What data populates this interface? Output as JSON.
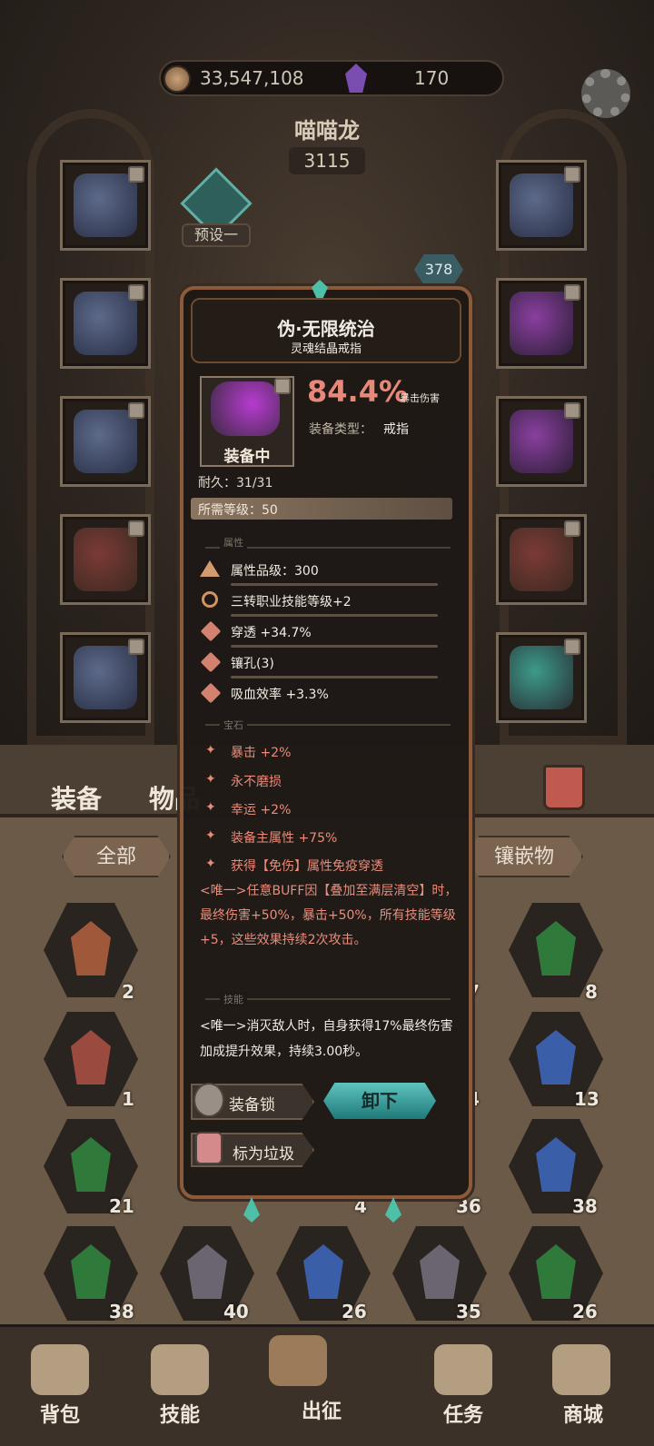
{
  "currency": {
    "gold": "33,547,108",
    "gems": "170"
  },
  "hero": {
    "name": "喵喵龙",
    "power": "3115",
    "preset": "预设一",
    "level": "378"
  },
  "inventory": {
    "tab_equip": "装备",
    "tab_items": "物品",
    "filter_all": "全部",
    "filter_gems": "镶嵌物",
    "counts": [
      "2",
      "8",
      "1",
      "13",
      "21",
      "36",
      "38",
      "38",
      "40",
      "26",
      "35",
      "26",
      "7",
      "4",
      "4"
    ]
  },
  "nav": [
    "背包",
    "技能",
    "出征",
    "任务",
    "商城"
  ],
  "tooltip": {
    "title": "伪·无限统治",
    "subtitle": "灵魂结晶戒指",
    "equipped": "装备中",
    "percent": "84.4%",
    "stat_name": "暴击伤害",
    "type_label": "装备类型：",
    "type_value": "戒指",
    "durability": "耐久：31/31",
    "required_level": "所需等级：50",
    "section_attrs": "属性",
    "attrs": [
      "属性品级：300",
      "三转职业技能等级+2",
      "穿透 +34.7%",
      "镶孔(3)",
      "吸血效率 +3.3%"
    ],
    "section_gems": "宝石",
    "gems": [
      "暴击 +2%",
      "永不磨损",
      "幸运 +2%",
      "装备主属性 +75%",
      "获得【免伤】属性免疫穿透"
    ],
    "unique1": "<唯一>任意BUFF因【叠加至满层清空】时，最终伤害+50%，暴击+50%，所有技能等级+5，这些效果持续2次攻击。",
    "section_skills": "技能",
    "unique2": "<唯一>消灭敌人时，自身获得17%最终伤害加成提升效果，持续3.00秒。",
    "lock_button": "装备锁",
    "unequip_button": "卸下",
    "junk_button": "标为垃圾"
  }
}
